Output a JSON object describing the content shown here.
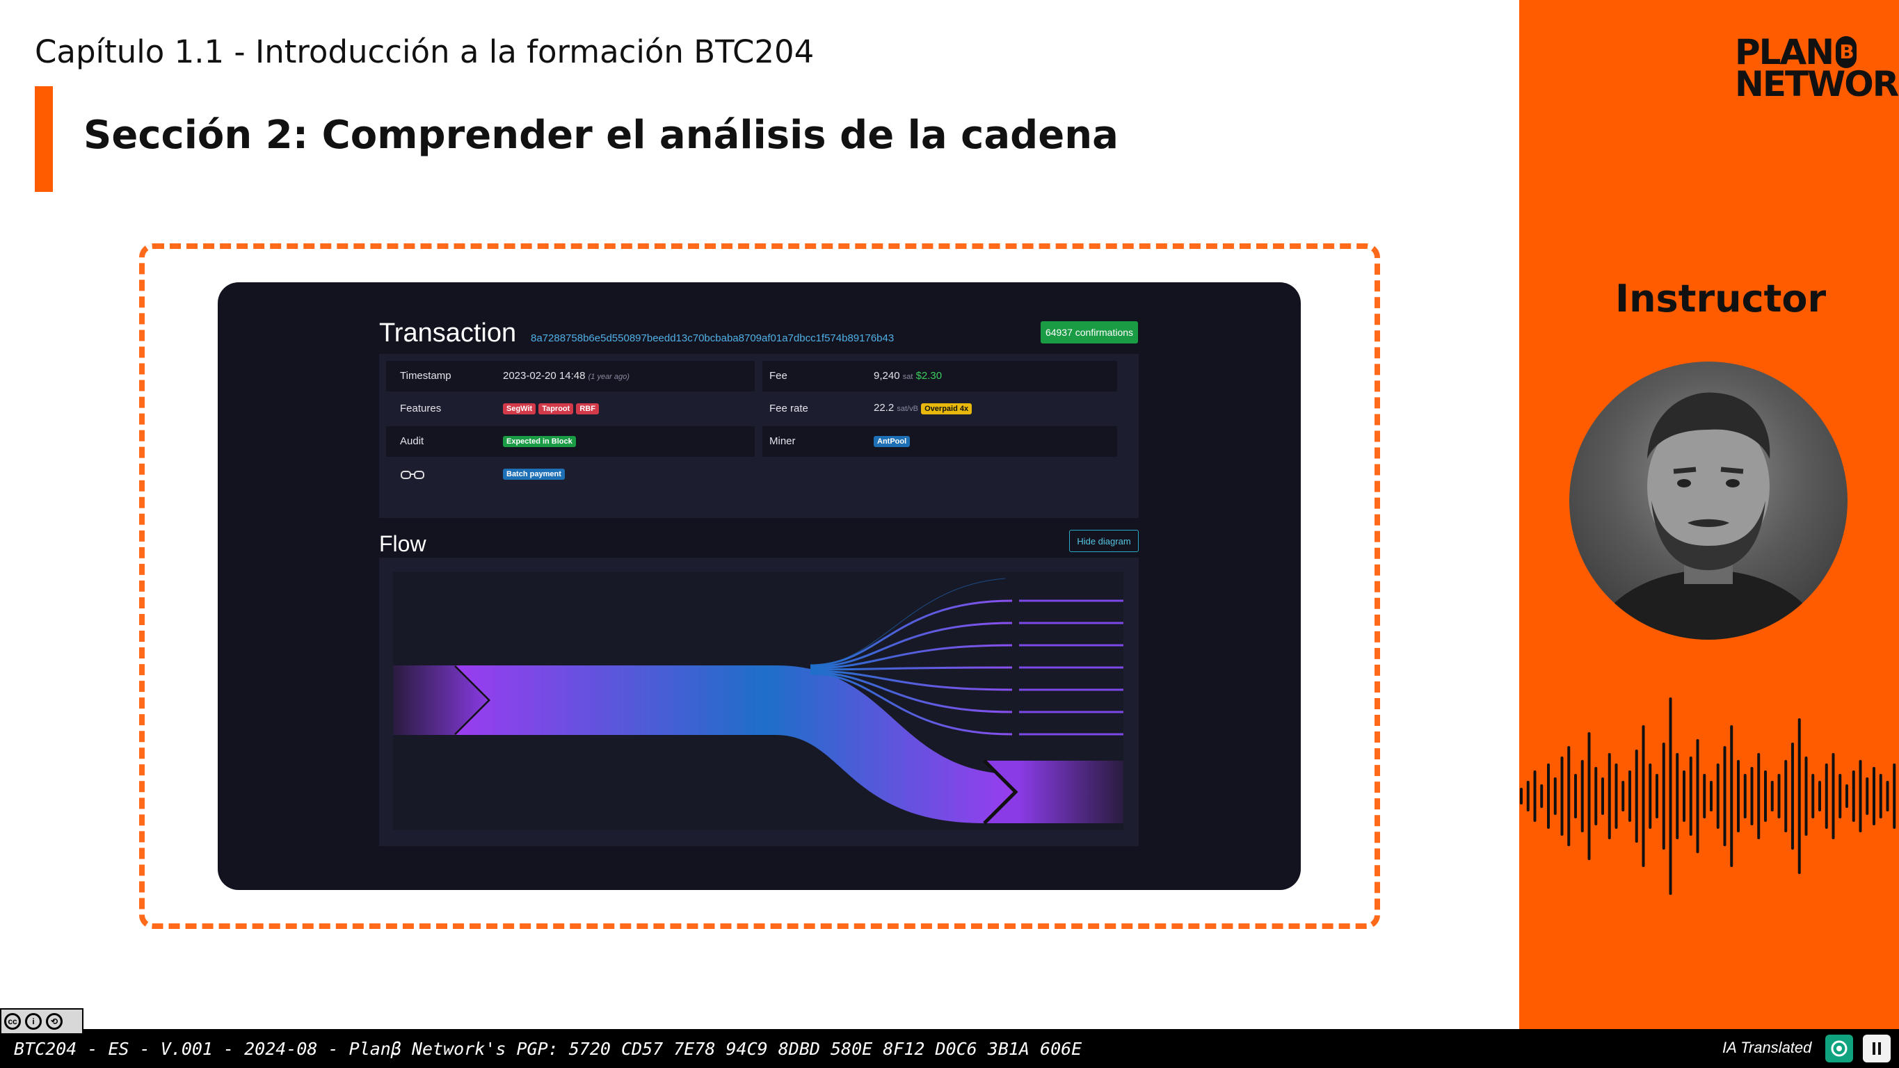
{
  "header": {
    "chapter": "Capítulo 1.1 - Introducción a la formación BTC204",
    "section": "Sección 2: Comprender el análisis de la cadena"
  },
  "transaction": {
    "title": "Transaction",
    "hash": "8a7288758b6e5d550897beedd13c70bcbaba8709af01a7dbcc1f574b89176b43",
    "confirmations": "64937 confirmations",
    "timestamp_label": "Timestamp",
    "timestamp_value": "2023-02-20 14:48",
    "timestamp_ago": "(1 year ago)",
    "features_label": "Features",
    "features": [
      "SegWit",
      "Taproot",
      "RBF"
    ],
    "audit_label": "Audit",
    "audit_value": "Expected in Block",
    "batch_label": "Batch payment",
    "fee_label": "Fee",
    "fee_value": "9,240",
    "fee_unit": "sat",
    "fee_usd": "$2.30",
    "feerate_label": "Fee rate",
    "feerate_value": "22.2",
    "feerate_unit": "sat/vB",
    "overpaid": "Overpaid 4x",
    "miner_label": "Miner",
    "miner_value": "AntPool"
  },
  "flow": {
    "title": "Flow",
    "hide_button": "Hide diagram"
  },
  "sidebar": {
    "logo_line1": "PLAN",
    "logo_b": "B",
    "logo_line2": "NETWORK",
    "instructor": "Instructor"
  },
  "footer": {
    "text": "BTC204 - ES - V.001 - 2024-08 - Planβ Network's PGP: 5720 CD57 7E78 94C9 8DBD 580E 8F12 D0C6 3B1A 606E",
    "ia": "IA Translated",
    "cc_labels": [
      "cc",
      "i",
      "⟲"
    ]
  },
  "colors": {
    "accent": "#ff5c00",
    "dark_bg": "#13131f",
    "segwit": "#d23a4a",
    "audit": "#1a9c45",
    "miner": "#1d6fb6",
    "overpaid": "#e8b90c"
  }
}
